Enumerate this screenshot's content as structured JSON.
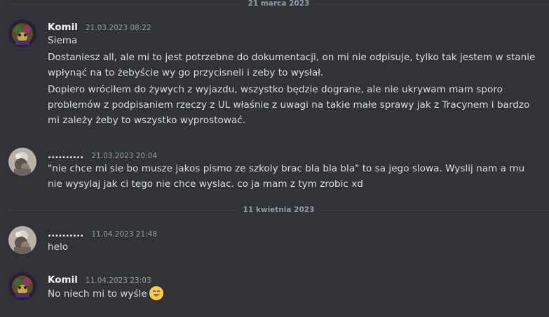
{
  "dividers": {
    "march": "21 marca 2023",
    "april": "11 kwietnia 2023"
  },
  "messages": [
    {
      "author": "Komil",
      "timestamp": "21.03.2023 08:22",
      "lines": [
        "Siema",
        "Dostaniesz all, ale mi to jest potrzebne do dokumentacji, on mi nie odpisuje, tylko tak jestem w stanie wpłynąć na to żebyście wy go przycisneli i zeby to wysłał.",
        "Dopiero wróciłem do żywych z wyjazdu, wszystko będzie dograne, ale nie ukrywam mam sporo problemów z podpisaniem rzeczy z UL właśnie z uwagi na takie małe sprawy jak z Tracynem i bardzo mi zależy żeby to wszystko wyprostować."
      ]
    },
    {
      "author": "..........",
      "timestamp": "21.03.2023 20:04",
      "lines": [
        "\"nie chce mi sie bo musze jakos pismo ze szkoly brac bla bla bla\" to sa jego slowa. Wyslij nam a mu nie wysylaj jak ci tego nie chce wyslac. co ja mam z tym zrobic xd"
      ]
    },
    {
      "author": "..........",
      "timestamp": "11.04.2023 21:48",
      "lines": [
        "helo"
      ]
    },
    {
      "author": "Komil",
      "timestamp": "11.04.2023 23:03",
      "lines": [
        "No niech mi to wyśle"
      ],
      "emoji": "grinning-face-emoji"
    }
  ],
  "colors": {
    "background": "#313338",
    "text": "#dbdee1",
    "username": "#f2f3f5",
    "muted": "#949ba4",
    "divider": "#3f4147"
  }
}
